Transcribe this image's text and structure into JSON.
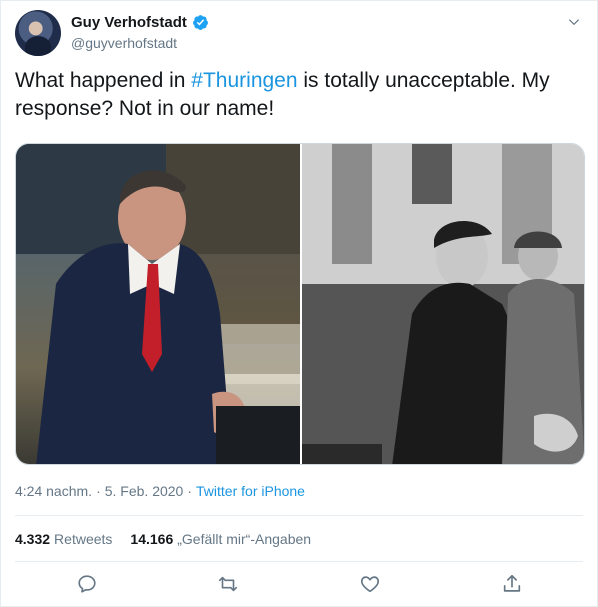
{
  "user": {
    "display_name": "Guy Verhofstadt",
    "handle": "@guyverhofstadt"
  },
  "tweet": {
    "text_before": "What happened in ",
    "hashtag": "#Thuringen",
    "text_after": " is totally unacceptable. My response? Not in our name!"
  },
  "meta": {
    "time": "4:24 nachm.",
    "separator1": "·",
    "date": "5. Feb. 2020",
    "separator2": "·",
    "source": "Twitter for iPhone"
  },
  "stats": {
    "retweets_count": "4.332",
    "retweets_label": "Retweets",
    "likes_count": "14.166",
    "likes_label": "„Gefällt mir“-Angaben"
  },
  "colors": {
    "accent": "#1b95e0",
    "secondary_text": "#657786",
    "primary_text": "#14171a",
    "verified": "#1da1f2"
  },
  "icons": {
    "reply": "reply-icon",
    "retweet": "retweet-icon",
    "like": "like-icon",
    "share": "share-icon",
    "verified": "verified-badge-icon",
    "more": "chevron-down-icon"
  }
}
